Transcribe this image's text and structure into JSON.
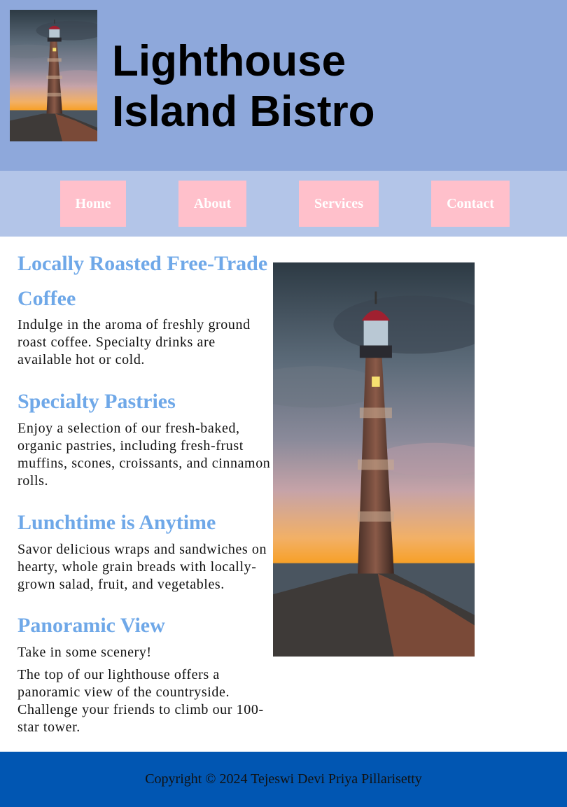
{
  "header": {
    "title_line1": "Lighthouse",
    "title_line2": "Island Bistro",
    "logo_icon": "lighthouse-image"
  },
  "nav": {
    "items": [
      {
        "label": "Home"
      },
      {
        "label": "About"
      },
      {
        "label": "Services"
      },
      {
        "label": "Contact"
      }
    ]
  },
  "sections": [
    {
      "heading": "Locally Roasted Free-Trade Coffee",
      "paragraphs": [
        "Indulge in the aroma of freshly ground roast coffee. Specialty drinks are available hot or cold."
      ]
    },
    {
      "heading": "Specialty Pastries",
      "paragraphs": [
        "Enjoy a selection of our fresh-baked, organic pastries, including fresh-frust muffins, scones, croissants, and cinnamon rolls."
      ]
    },
    {
      "heading": "Lunchtime is Anytime",
      "paragraphs": [
        "Savor delicious wraps and sandwiches on hearty, whole grain breads with locally-grown salad, fruit, and vegetables."
      ]
    },
    {
      "heading": "Panoramic View",
      "paragraphs": [
        "Take in some scenery!",
        "The top of our lighthouse offers a panoramic view of the countryside. Challenge your friends to climb our 100-star tower."
      ]
    }
  ],
  "footer": {
    "copyright": "Copyright © 2024 Tejeswi Devi Priya Pillarisetty"
  },
  "colors": {
    "header_bg": "#8ea8db",
    "nav_bg": "#b3c5e8",
    "nav_button_bg": "#ffc0cb",
    "heading": "#6fa8e8",
    "footer_bg": "#0156b2"
  }
}
